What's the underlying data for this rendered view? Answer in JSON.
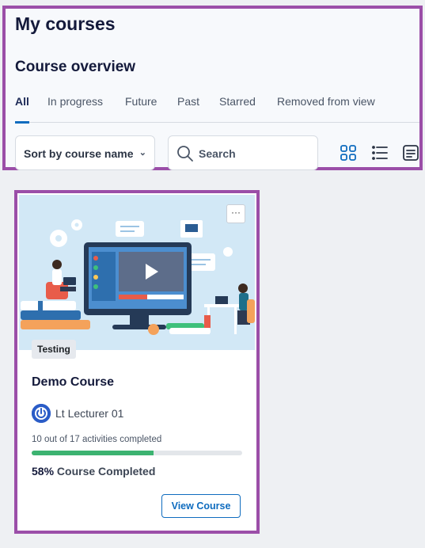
{
  "header": {
    "title": "My courses",
    "section_title": "Course overview"
  },
  "tabs": [
    {
      "label": "All",
      "active": true
    },
    {
      "label": "In progress"
    },
    {
      "label": "Future"
    },
    {
      "label": "Past"
    },
    {
      "label": "Starred"
    },
    {
      "label": "Removed from view"
    }
  ],
  "controls": {
    "sort_label": "Sort by course name",
    "sort_icon": "chevron-down-icon",
    "search_placeholder": "Search",
    "view_icons": [
      "card-view-icon",
      "list-view-icon",
      "summary-view-icon"
    ]
  },
  "course": {
    "badge": "Testing",
    "name": "Demo Course",
    "lecturer": "Lt Lecturer 01",
    "activities_text": "10 out of 17 activities completed",
    "progress_percent": 58,
    "completed_pct": "58%",
    "completed_text": " Course Completed",
    "menu_label": "···",
    "view_button": "View Course"
  },
  "colors": {
    "accent": "#0f6cbf",
    "progress": "#3cb371",
    "highlight_border": "#9b4ea8",
    "card_image_bg": "#d2e8f6"
  }
}
